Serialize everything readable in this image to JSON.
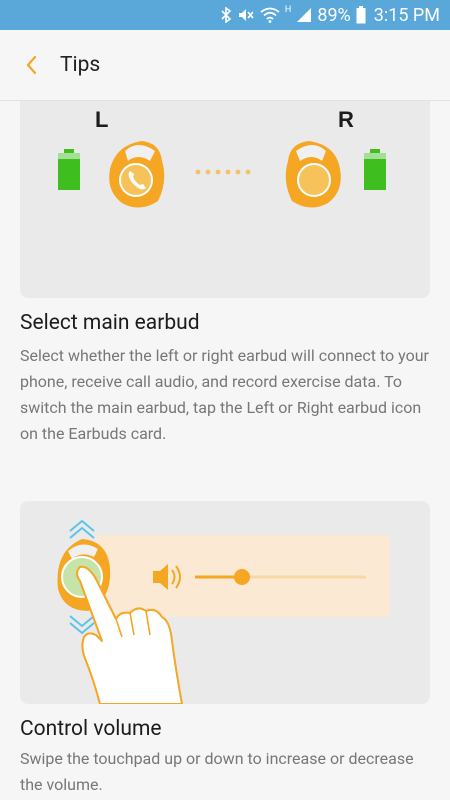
{
  "status": {
    "battery_percent": "89%",
    "time": "3:15 PM",
    "network_type": "H",
    "icons": [
      "bluetooth-icon",
      "mute-icon",
      "wifi-icon",
      "signal-icon",
      "battery-icon"
    ]
  },
  "header": {
    "title": "Tips",
    "back_icon": "chevron-left-icon"
  },
  "sections": [
    {
      "illustration": {
        "left_label": "L",
        "right_label": "R"
      },
      "title": "Select main earbud",
      "body": "Select whether the left or right earbud will connect to your phone, receive call audio, and record exercise data. To switch the main earbud, tap the Left or Right earbud icon on the Earbuds card."
    },
    {
      "title": "Control volume",
      "body": "Swipe the touchpad up or down to increase or decrease the volume."
    }
  ],
  "colors": {
    "status_bar": "#59a8d9",
    "accent": "#f5a623",
    "battery_green": "#3fbf1f",
    "card_bg": "#eaeaea"
  }
}
